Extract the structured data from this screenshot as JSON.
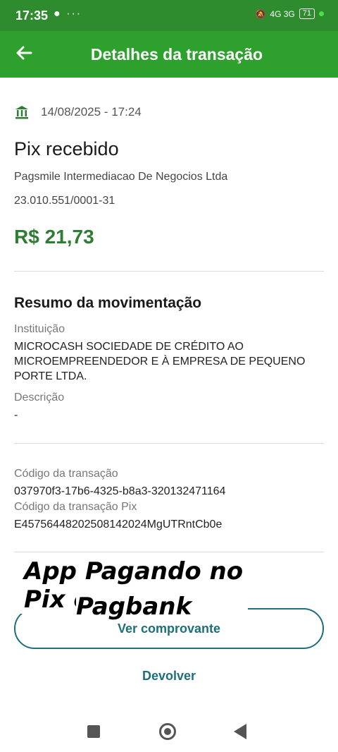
{
  "status_bar": {
    "time": "17:35",
    "left_icons": "● ···",
    "network": "4G 3G",
    "battery": "71"
  },
  "header": {
    "title": "Detalhes da transação"
  },
  "transaction": {
    "datetime": "14/08/2025 - 17:24",
    "title": "Pix recebido",
    "counterparty": "Pagsmile Intermediacao De Negocios Ltda",
    "document": "23.010.551/0001-31",
    "amount": "R$ 21,73"
  },
  "summary": {
    "heading": "Resumo da movimentação",
    "institution_label": "Instituição",
    "institution_value": "MICROCASH SOCIEDADE DE CRÉDITO AO MICROEMPREENDEDOR E À EMPRESA DE PEQUENO PORTE LTDA.",
    "description_label": "Descrição",
    "description_value": "-"
  },
  "codes": {
    "transaction_label": "Código da transação",
    "transaction_value": "037970f3-17b6-4325-b8a3-320132471164",
    "pix_label": "Código da transação Pix",
    "pix_value": "E45756448202508142024MgUTRntCb0e"
  },
  "actions": {
    "receipt_label": "Ver comprovante",
    "refund_label": "Devolver"
  },
  "overlay": {
    "line1": "App Pagando no Pix e",
    "line2": "Pagbank"
  },
  "colors": {
    "header": "#2ea02e",
    "amount": "#2e7d32",
    "accent": "#1d6f7a"
  }
}
